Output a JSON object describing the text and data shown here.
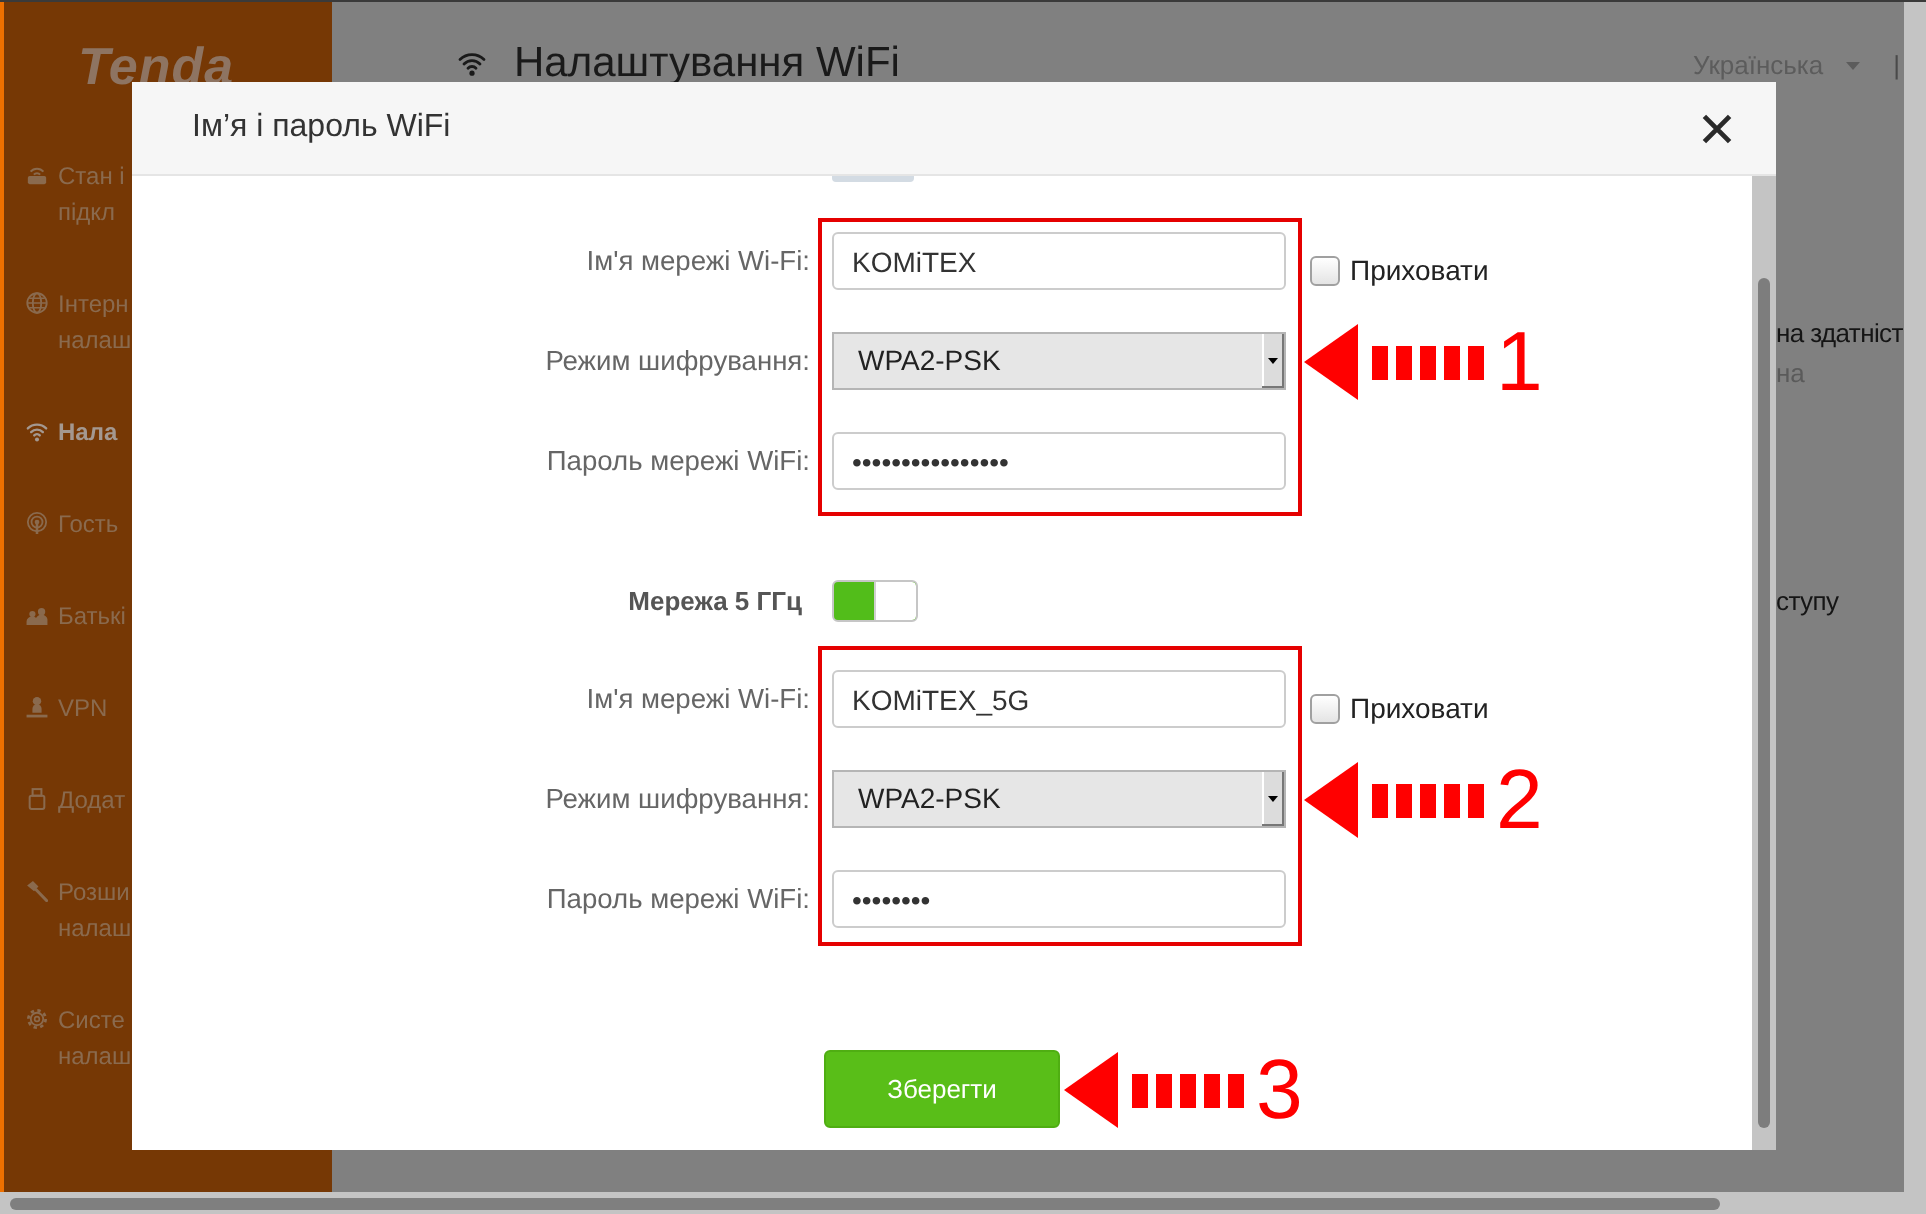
{
  "sidebar": {
    "logo": "Tenda",
    "items": [
      {
        "lines": [
          "Стан і",
          "підкл"
        ],
        "selected": false
      },
      {
        "lines": [
          "Інтерн",
          "налаш"
        ],
        "selected": false
      },
      {
        "lines": [
          "Нала"
        ],
        "selected": true
      },
      {
        "lines": [
          "Гость"
        ],
        "selected": false
      },
      {
        "lines": [
          "Батькі"
        ],
        "selected": false
      },
      {
        "lines": [
          "VPN"
        ],
        "selected": false
      },
      {
        "lines": [
          "Додат"
        ],
        "selected": false
      },
      {
        "lines": [
          "Розши",
          "налаш"
        ],
        "selected": false
      },
      {
        "lines": [
          "Систе",
          "налаш"
        ],
        "selected": false
      }
    ]
  },
  "page_header": {
    "title": "Налаштування WiFi",
    "language": "Українська",
    "separator": "|"
  },
  "page_content": [
    {
      "kind": "heading",
      "text": "на здатніст"
    },
    {
      "kind": "hint",
      "text": "на"
    },
    {
      "kind": "heading",
      "text": "ступу"
    }
  ],
  "dialog": {
    "title": "Ім’я і пароль WiFi",
    "sections": [
      {
        "annotation": "1",
        "fields": [
          {
            "kind": "text",
            "label": "Ім'я мережі Wi-Fi:",
            "value": "KOMiTEX",
            "hide": {
              "label": "Приховати",
              "checked": false
            }
          },
          {
            "kind": "select",
            "label": "Режим шифрування:",
            "value": "WPA2-PSK"
          },
          {
            "kind": "password",
            "label": "Пароль мережі WiFi:",
            "value": "••••••••••••••••"
          }
        ]
      },
      {
        "switch": {
          "label": "Мережа 5 ГГц",
          "on": true
        },
        "annotation": "2",
        "fields": [
          {
            "kind": "text",
            "label": "Ім'я мережі Wi-Fi:",
            "value": "KOMiTEX_5G",
            "hide": {
              "label": "Приховати",
              "checked": false
            }
          },
          {
            "kind": "select",
            "label": "Режим шифрування:",
            "value": "WPA2-PSK"
          },
          {
            "kind": "password",
            "label": "Пароль мережі WiFi:",
            "value": "••••••••"
          }
        ]
      }
    ],
    "save_button": "Зберегти",
    "save_annotation": "3"
  }
}
